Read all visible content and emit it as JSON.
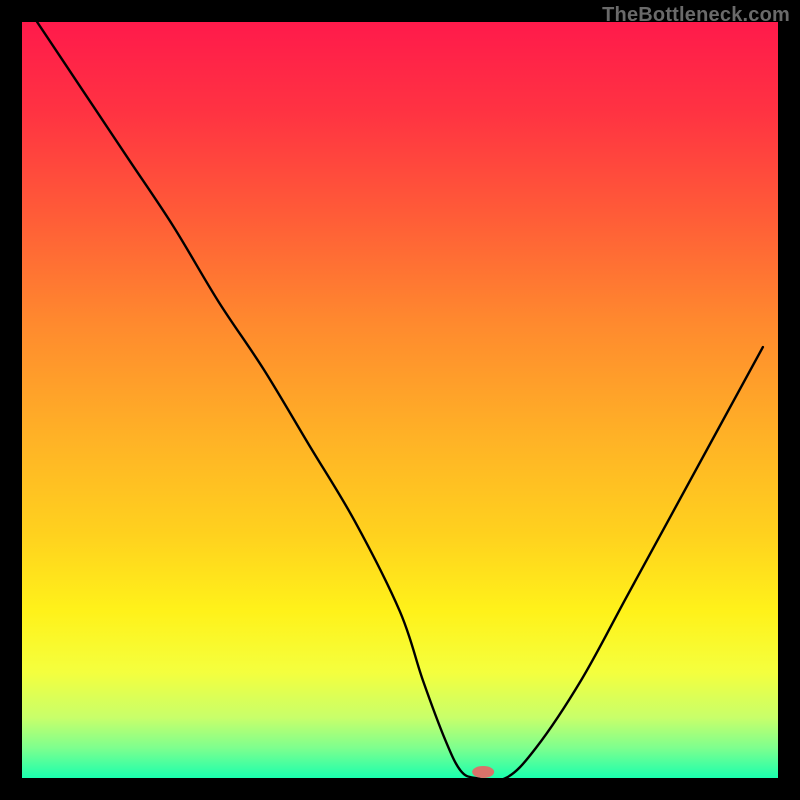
{
  "watermark": "TheBottleneck.com",
  "chart_data": {
    "type": "line",
    "title": "",
    "xlabel": "",
    "ylabel": "",
    "xlim": [
      0,
      100
    ],
    "ylim": [
      0,
      100
    ],
    "x": [
      2,
      8,
      14,
      20,
      26,
      32,
      38,
      44,
      50,
      53,
      56,
      58,
      60,
      64,
      68,
      74,
      80,
      86,
      92,
      98
    ],
    "values": [
      100,
      91,
      82,
      73,
      63,
      54,
      44,
      34,
      22,
      13,
      5,
      1,
      0,
      0,
      4,
      13,
      24,
      35,
      46,
      57
    ],
    "marker": {
      "x": 61,
      "y": 0.8,
      "color": "#d9726a"
    },
    "gradient_stops": [
      {
        "offset": 0,
        "color": "#ff1a4b"
      },
      {
        "offset": 12,
        "color": "#ff3342"
      },
      {
        "offset": 25,
        "color": "#ff5a38"
      },
      {
        "offset": 40,
        "color": "#ff8a2e"
      },
      {
        "offset": 55,
        "color": "#ffb226"
      },
      {
        "offset": 68,
        "color": "#ffd21e"
      },
      {
        "offset": 78,
        "color": "#fff21a"
      },
      {
        "offset": 86,
        "color": "#f4ff3e"
      },
      {
        "offset": 92,
        "color": "#c8ff6a"
      },
      {
        "offset": 96,
        "color": "#7eff8e"
      },
      {
        "offset": 100,
        "color": "#1affae"
      }
    ]
  }
}
